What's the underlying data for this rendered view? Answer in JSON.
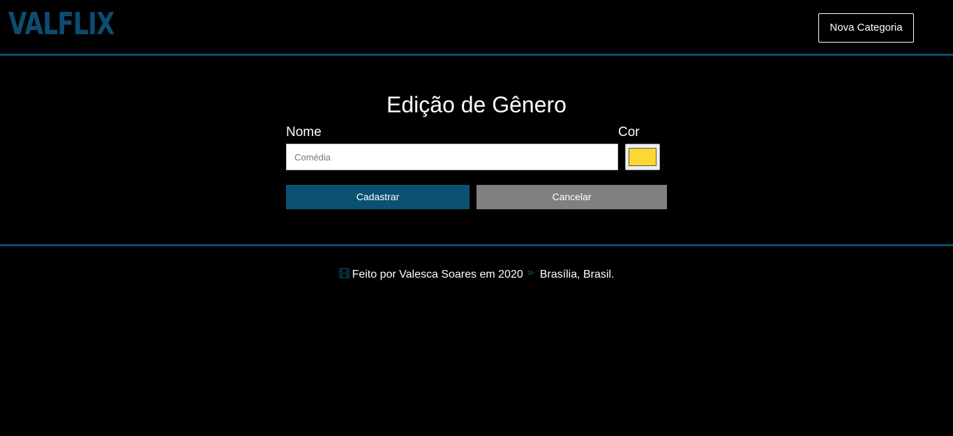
{
  "brand": {
    "logo": "VALFLIX",
    "accent_color": "#0b4d70"
  },
  "header": {
    "nav_button_label": "Nova Categoria"
  },
  "form": {
    "title": "Edição de Gênero",
    "name_label": "Nome",
    "name_placeholder": "Comédia",
    "name_value": "",
    "color_label": "Cor",
    "color_value": "#fdd835",
    "submit_label": "Cadastrar",
    "submit_color": "#0b5172",
    "cancel_label": "Cancelar",
    "cancel_color": "#808080"
  },
  "footer": {
    "icon": "film-icon",
    "separator_icon": "double-chevron-right-icon",
    "credit_text": "Feito por Valesca Soares em 2020",
    "location_text": "Brasília, Brasil."
  }
}
